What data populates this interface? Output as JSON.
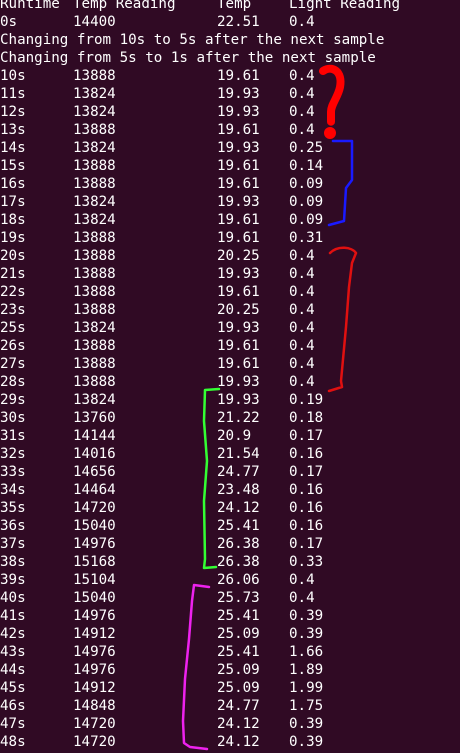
{
  "terminal": {
    "background": "#300a24",
    "foreground": "#ffffff",
    "header": [
      "Runtime",
      "Temp Reading",
      "Temp",
      "Light Reading"
    ],
    "rows": [
      [
        "0s",
        "14400",
        "22.51",
        "0.4"
      ],
      {
        "message": "Changing from 10s to 5s after the next sample"
      },
      {
        "message": "Changing from 5s to 1s after the next sample"
      },
      [
        "10s",
        "13888",
        "19.61",
        "0.4"
      ],
      [
        "11s",
        "13824",
        "19.93",
        "0.4"
      ],
      [
        "12s",
        "13824",
        "19.93",
        "0.4"
      ],
      [
        "13s",
        "13888",
        "19.61",
        "0.4"
      ],
      [
        "14s",
        "13824",
        "19.93",
        "0.25"
      ],
      [
        "15s",
        "13888",
        "19.61",
        "0.14"
      ],
      [
        "16s",
        "13888",
        "19.61",
        "0.09"
      ],
      [
        "17s",
        "13824",
        "19.93",
        "0.09"
      ],
      [
        "18s",
        "13824",
        "19.61",
        "0.09"
      ],
      [
        "19s",
        "13888",
        "19.61",
        "0.31"
      ],
      [
        "20s",
        "13888",
        "20.25",
        "0.4"
      ],
      [
        "21s",
        "13888",
        "19.93",
        "0.4"
      ],
      [
        "22s",
        "13888",
        "19.61",
        "0.4"
      ],
      [
        "23s",
        "13888",
        "20.25",
        "0.4"
      ],
      [
        "25s",
        "13824",
        "19.93",
        "0.4"
      ],
      [
        "26s",
        "13888",
        "19.61",
        "0.4"
      ],
      [
        "27s",
        "13888",
        "19.61",
        "0.4"
      ],
      [
        "28s",
        "13888",
        "19.93",
        "0.4"
      ],
      [
        "29s",
        "13824",
        "19.93",
        "0.19"
      ],
      [
        "30s",
        "13760",
        "21.22",
        "0.18"
      ],
      [
        "31s",
        "14144",
        "20.9",
        "0.17"
      ],
      [
        "32s",
        "14016",
        "21.54",
        "0.16"
      ],
      [
        "33s",
        "14656",
        "24.77",
        "0.17"
      ],
      [
        "34s",
        "14464",
        "23.48",
        "0.16"
      ],
      [
        "35s",
        "14720",
        "24.12",
        "0.16"
      ],
      [
        "36s",
        "15040",
        "25.41",
        "0.16"
      ],
      [
        "37s",
        "14976",
        "26.38",
        "0.17"
      ],
      [
        "38s",
        "15168",
        "26.38",
        "0.33"
      ],
      [
        "39s",
        "15104",
        "26.06",
        "0.4"
      ],
      [
        "40s",
        "15040",
        "25.73",
        "0.4"
      ],
      [
        "41s",
        "14976",
        "25.41",
        "0.39"
      ],
      [
        "42s",
        "14912",
        "25.09",
        "0.39"
      ],
      [
        "43s",
        "14976",
        "25.41",
        "1.66"
      ],
      [
        "44s",
        "14976",
        "25.09",
        "1.89"
      ],
      [
        "45s",
        "14912",
        "25.09",
        "1.99"
      ],
      [
        "46s",
        "14848",
        "24.77",
        "1.75"
      ],
      [
        "47s",
        "14720",
        "24.12",
        "0.39"
      ],
      [
        "48s",
        "14720",
        "24.12",
        "0.39"
      ]
    ]
  },
  "annotations": [
    {
      "name": "red-question-mark-annotation",
      "color": "#ff0000",
      "first_row": 3,
      "last_row": 6
    },
    {
      "name": "blue-bracket-annotation",
      "color": "#1a1aff",
      "first_row": 7,
      "last_row": 11
    },
    {
      "name": "red-bracket-annotation",
      "color": "#e01010",
      "first_row": 13,
      "last_row": 20
    },
    {
      "name": "green-bracket-annotation",
      "color": "#33ff33",
      "first_row": 21,
      "last_row": 30
    },
    {
      "name": "magenta-bracket-annotation",
      "color": "#ee22ee",
      "first_row": 32,
      "last_row": 40
    }
  ]
}
